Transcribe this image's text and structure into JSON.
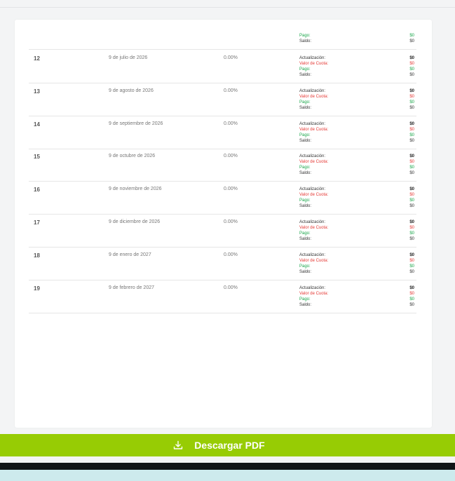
{
  "partial_row": {
    "labels": [
      "Pago:",
      "Saldo:"
    ],
    "values": [
      "$0",
      "$0"
    ]
  },
  "row_labels": [
    "Actualización:",
    "Valor de Cuota:",
    "Pago:",
    "Saldo:"
  ],
  "rows": [
    {
      "num": "12",
      "date": "9 de julio de 2026",
      "rate": "0.00%",
      "values": [
        "$0",
        "$0",
        "$0",
        "$0"
      ]
    },
    {
      "num": "13",
      "date": "9 de agosto de 2026",
      "rate": "0.00%",
      "values": [
        "$0",
        "$0",
        "$0",
        "$0"
      ]
    },
    {
      "num": "14",
      "date": "9 de septiembre de 2026",
      "rate": "0.00%",
      "values": [
        "$0",
        "$0",
        "$0",
        "$0"
      ]
    },
    {
      "num": "15",
      "date": "9 de octubre de 2026",
      "rate": "0.00%",
      "values": [
        "$0",
        "$0",
        "$0",
        "$0"
      ]
    },
    {
      "num": "16",
      "date": "9 de noviembre de 2026",
      "rate": "0.00%",
      "values": [
        "$0",
        "$0",
        "$0",
        "$0"
      ]
    },
    {
      "num": "17",
      "date": "9 de diciembre de 2026",
      "rate": "0.00%",
      "values": [
        "$0",
        "$0",
        "$0",
        "$0"
      ]
    },
    {
      "num": "18",
      "date": "9 de enero de 2027",
      "rate": "0.00%",
      "values": [
        "$0",
        "$0",
        "$0",
        "$0"
      ]
    },
    {
      "num": "19",
      "date": "9 de febrero de 2027",
      "rate": "0.00%",
      "values": [
        "$0",
        "$0",
        "$0",
        "$0"
      ]
    }
  ],
  "download_button": {
    "label": "Descargar PDF",
    "icon": "download-icon"
  },
  "colors": {
    "button": "#97cc04",
    "red": "#e53935",
    "green": "#1aa64a"
  }
}
